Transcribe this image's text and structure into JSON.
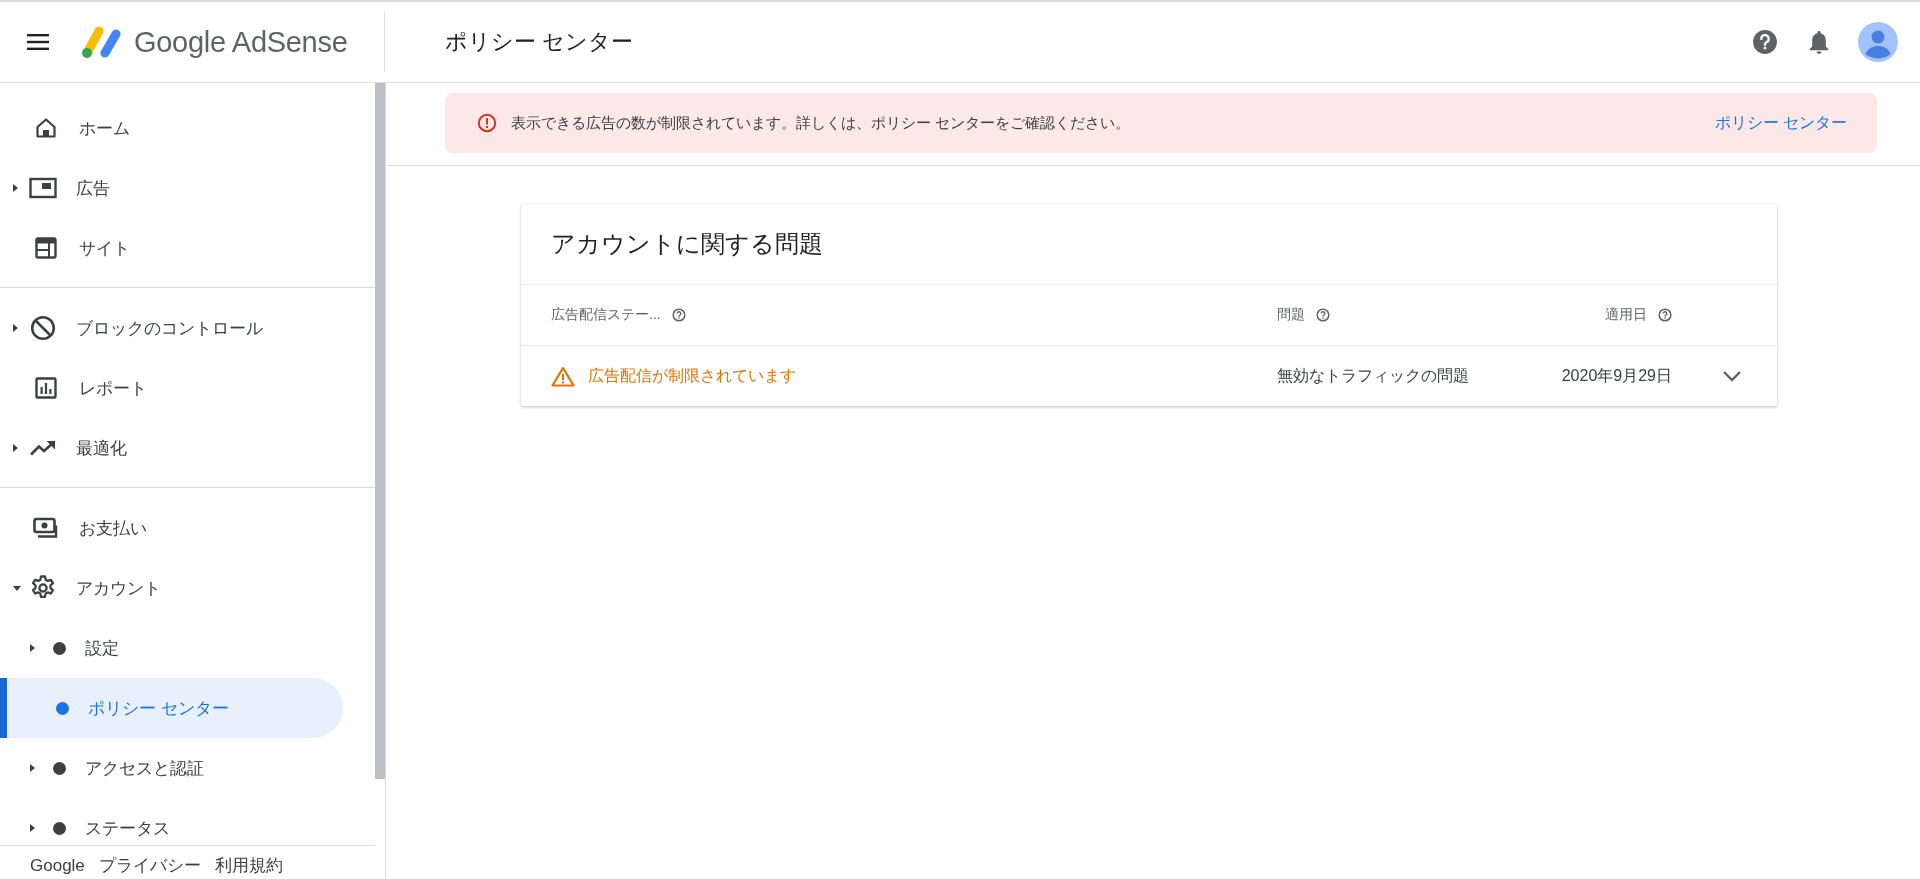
{
  "header": {
    "product": "Google AdSense",
    "page_title": "ポリシー センター"
  },
  "nav": {
    "sections": [
      {
        "items": [
          {
            "label": "ホーム",
            "selected": false
          },
          {
            "label": "広告",
            "selected": false,
            "expanded": false
          },
          {
            "label": "サイト",
            "selected": false
          }
        ]
      },
      {
        "items": [
          {
            "label": "ブロックのコントロール",
            "selected": false,
            "expanded": false
          },
          {
            "label": "レポート",
            "selected": false
          },
          {
            "label": "最適化",
            "selected": false,
            "expanded": false
          }
        ]
      },
      {
        "items": [
          {
            "label": "お支払い",
            "selected": false
          },
          {
            "label": "アカウント",
            "selected": false,
            "expanded": true,
            "children": [
              {
                "label": "設定",
                "selected": false,
                "expanded": false
              },
              {
                "label": "ポリシー センター",
                "selected": true
              },
              {
                "label": "アクセスと認証",
                "selected": false,
                "expanded": false
              },
              {
                "label": "ステータス",
                "selected": false,
                "expanded": false
              }
            ]
          }
        ]
      }
    ],
    "footer_links": [
      "Google",
      "プライバシー",
      "利用規約"
    ]
  },
  "banner": {
    "message": "表示できる広告の数が制限されています。詳しくは、ポリシー センターをご確認ください。",
    "link": "ポリシー センター"
  },
  "issues_card": {
    "title": "アカウントに関する問題",
    "columns": [
      "広告配信ステー...",
      "問題",
      "適用日"
    ],
    "rows": [
      {
        "status": "広告配信が制限されています",
        "issue": "無効なトラフィックの問題",
        "date": "2020年9月29日",
        "expanded": false
      }
    ]
  }
}
